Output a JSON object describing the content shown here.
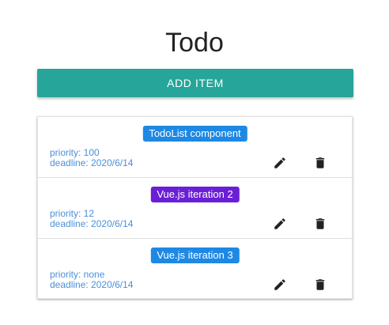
{
  "header": {
    "title": "Todo"
  },
  "toolbar": {
    "add_label": "ADD ITEM",
    "add_color": "#26a69a"
  },
  "todos": [
    {
      "title": "TodoList component",
      "badge_color": "#1e88e5",
      "priority": "priority: 100",
      "deadline": "deadline: 2020/6/14"
    },
    {
      "title": "Vue.js iteration 2",
      "badge_color": "#6a1fd6",
      "priority": "priority: 12",
      "deadline": "deadline: 2020/6/14"
    },
    {
      "title": "Vue.js iteration 3",
      "badge_color": "#1e88e5",
      "priority": "priority: none",
      "deadline": "deadline: 2020/6/14"
    }
  ],
  "icons": {
    "edit": "pencil-icon",
    "delete": "trash-icon"
  }
}
